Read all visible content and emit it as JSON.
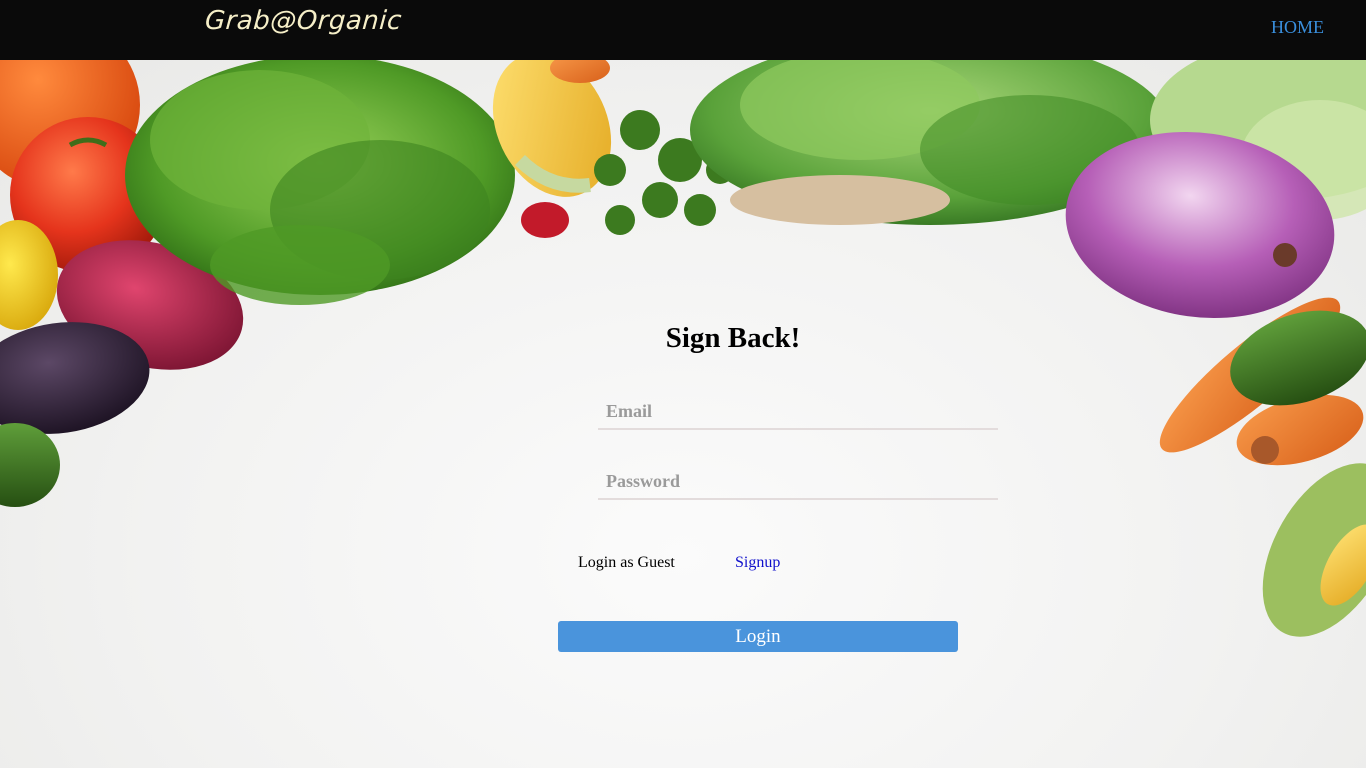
{
  "navbar": {
    "brand": "Grab@Organic",
    "home_link": "HOME"
  },
  "form": {
    "title": "Sign Back!",
    "email_placeholder": "Email",
    "password_placeholder": "Password",
    "guest_link": "Login as Guest",
    "signup_link": "Signup",
    "login_button": "Login"
  },
  "colors": {
    "navbar_bg": "#0a0a0a",
    "brand_text": "#f6efc8",
    "home_link": "#3a8fdd",
    "signup_link": "#1010cc",
    "login_button": "#4a94dc"
  }
}
